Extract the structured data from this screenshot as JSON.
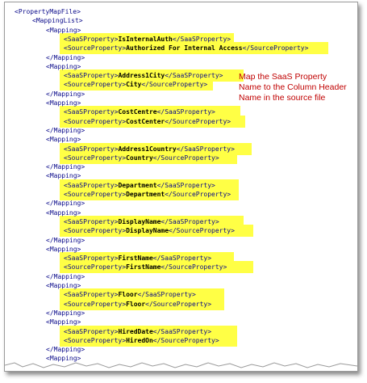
{
  "colors": {
    "highlight": "#ffff45",
    "annotation": "#c00000",
    "tag": "#0a0a8a"
  },
  "annotation": "Map the SaaS Property\nName to the Column Header\nName in the source file",
  "root_open": "<PropertyMapFile>",
  "list_open": "<MappingList>",
  "mapping_open": "<Mapping>",
  "mapping_close": "</Mapping>",
  "mappings": [
    {
      "saas_open": "<SaaSProperty>",
      "saas": "IsInternalAuth",
      "saas_close": "</SaaSProperty>",
      "src_open": "<SourceProperty>",
      "src": "Authorized For Internal Access",
      "src_close": "</SourceProperty>"
    },
    {
      "saas_open": "<SaaSProperty>",
      "saas": "Address1City",
      "saas_close": "</SaaSProperty>",
      "src_open": "<SourceProperty>",
      "src": "City",
      "src_close": "</SourceProperty>"
    },
    {
      "saas_open": "<SaaSProperty>",
      "saas": "CostCentre",
      "saas_close": "</SaaSProperty>",
      "src_open": "<SourceProperty>",
      "src": "CostCenter",
      "src_close": "</SourceProperty>"
    },
    {
      "saas_open": "<SaaSProperty>",
      "saas": "Address1Country",
      "saas_close": "</SaaSProperty>",
      "src_open": "<SourceProperty>",
      "src": "Country",
      "src_close": "</SourceProperty>"
    },
    {
      "saas_open": "<SaaSProperty>",
      "saas": "Department",
      "saas_close": "</SaaSProperty>",
      "src_open": "<SourceProperty>",
      "src": "Department",
      "src_close": "</SourceProperty>"
    },
    {
      "saas_open": "<SaaSProperty>",
      "saas": "DisplayName",
      "saas_close": "</SaaSProperty>",
      "src_open": "<SourceProperty>",
      "src": "DisplayName",
      "src_close": "</SourceProperty>"
    },
    {
      "saas_open": "<SaaSProperty>",
      "saas": "FirstName",
      "saas_close": "</SaaSProperty>",
      "src_open": "<SourceProperty>",
      "src": "FirstName",
      "src_close": "</SourceProperty>"
    },
    {
      "saas_open": "<SaaSProperty>",
      "saas": "Floor",
      "saas_close": "</SaaSProperty>",
      "src_open": "<SourceProperty>",
      "src": "Floor",
      "src_close": "</SourceProperty>"
    },
    {
      "saas_open": "<SaaSProperty>",
      "saas": "HiredDate",
      "saas_close": "</SaaSProperty>",
      "src_open": "<SourceProperty>",
      "src": "HiredOn",
      "src_close": "</SourceProperty>"
    }
  ]
}
